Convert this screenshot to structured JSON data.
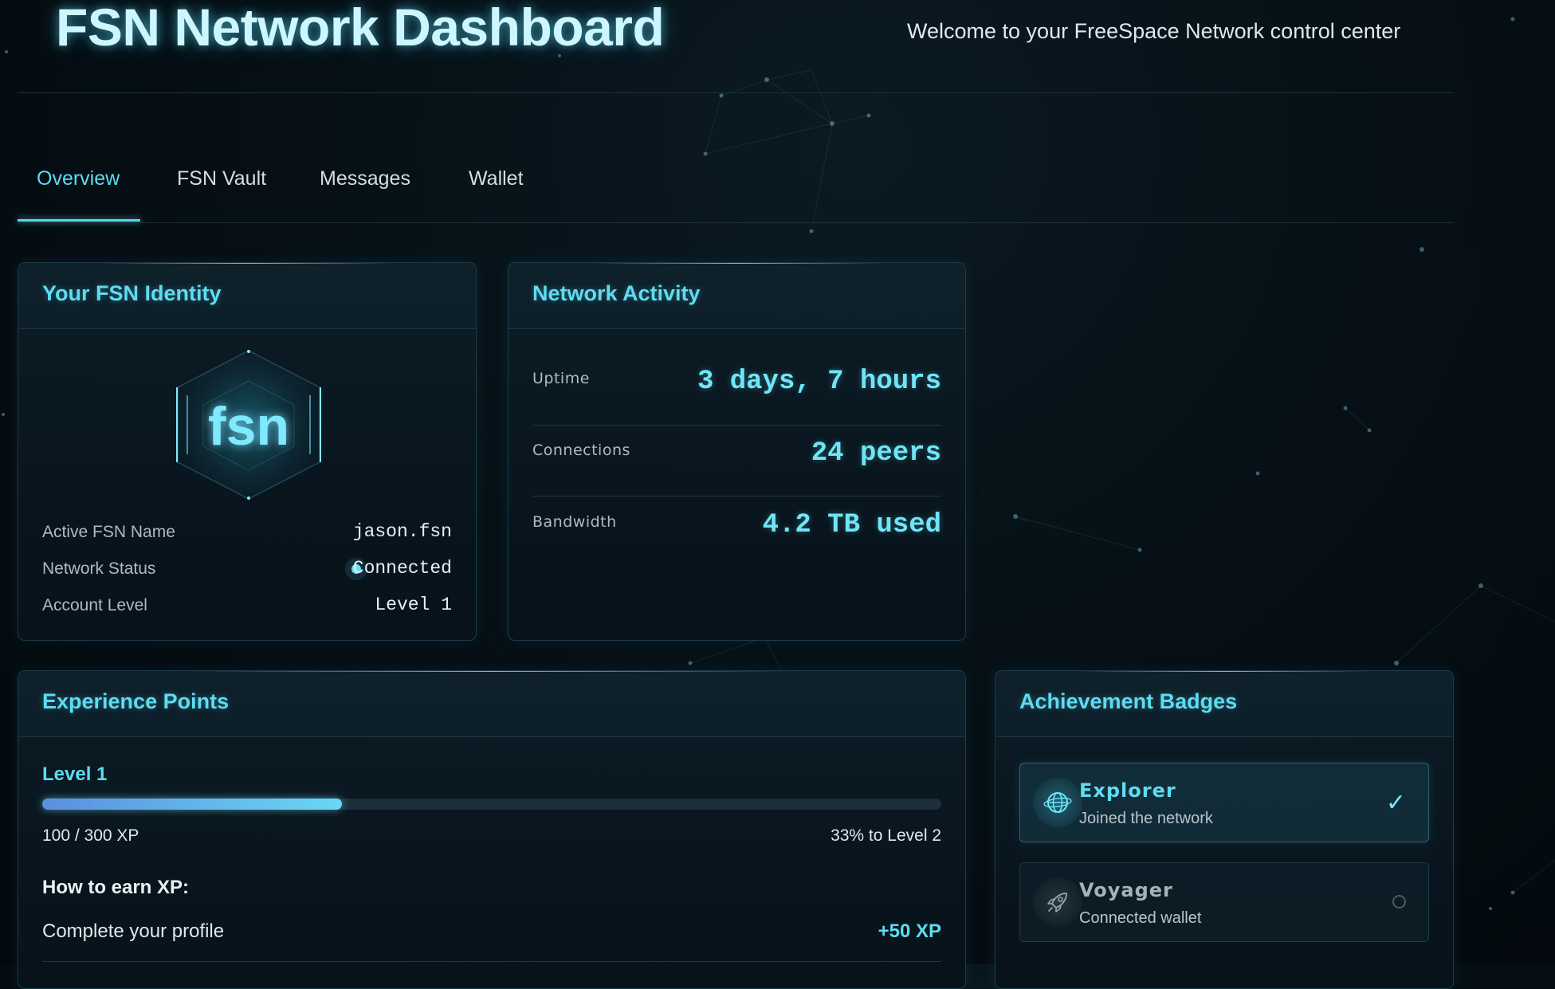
{
  "header": {
    "title": "FSN Network Dashboard",
    "welcome": "Welcome to your FreeSpace Network control center"
  },
  "tabs": [
    {
      "label": "Overview",
      "active": true
    },
    {
      "label": "FSN Vault",
      "active": false
    },
    {
      "label": "Messages",
      "active": false
    },
    {
      "label": "Wallet",
      "active": false
    }
  ],
  "identity": {
    "title": "Your FSN Identity",
    "logo_text": "fsn",
    "fields": [
      {
        "label": "Active FSN Name",
        "value": "jason.fsn"
      },
      {
        "label": "Network Status",
        "value": "Connected"
      },
      {
        "label": "Account Level",
        "value": "Level 1"
      }
    ]
  },
  "network": {
    "title": "Network Activity",
    "stats": [
      {
        "label": "Uptime",
        "value": "3 days, 7 hours"
      },
      {
        "label": "Connections",
        "value": "24 peers"
      },
      {
        "label": "Bandwidth",
        "value": "4.2 TB used"
      }
    ]
  },
  "xp": {
    "title": "Experience Points",
    "level_label": "Level 1",
    "progress": 0.3333,
    "count_text": "100 / 300 XP",
    "next_text": "33% to Level 2",
    "earn_title": "How to earn XP:",
    "tasks": [
      {
        "label": "Complete your profile",
        "xp": "+50 XP"
      }
    ]
  },
  "badges": {
    "title": "Achievement Badges",
    "items": [
      {
        "name": "Explorer",
        "desc": "Joined the network",
        "earned": true,
        "icon": "globe-icon"
      },
      {
        "name": "Voyager",
        "desc": "Connected wallet",
        "earned": false,
        "icon": "rocket-icon"
      }
    ]
  },
  "colors": {
    "accent": "#5ddcf2",
    "background": "#061016",
    "card": "#0b1c26",
    "border": "#1e3a48"
  }
}
